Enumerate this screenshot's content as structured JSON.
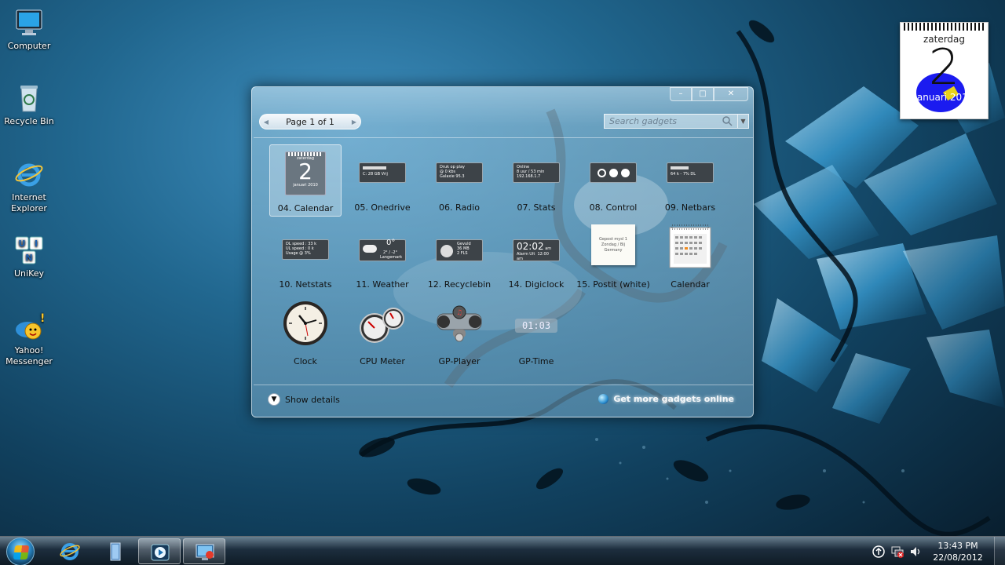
{
  "desktop": {
    "icons": [
      {
        "label": "Computer",
        "icon": "computer-icon"
      },
      {
        "label": "Recycle Bin",
        "icon": "recycle-bin-icon"
      },
      {
        "label": "Internet Explorer",
        "icon": "internet-explorer-icon"
      },
      {
        "label": "UniKey",
        "icon": "unikey-icon"
      },
      {
        "label": "Yahoo! Messenger",
        "icon": "yahoo-messenger-icon"
      }
    ]
  },
  "calendar_gadget": {
    "day_name": "zaterdag",
    "day_number": "2",
    "month_year": "januari 2010"
  },
  "gallery": {
    "page_label": "Page 1 of 1",
    "search_placeholder": "Search gadgets",
    "show_details": "Show details",
    "online_link": "Get more gadgets online",
    "gadgets": [
      {
        "name": "04. Calendar",
        "selected": true
      },
      {
        "name": "05. Onedrive"
      },
      {
        "name": "06. Radio"
      },
      {
        "name": "07. Stats"
      },
      {
        "name": "08. Control"
      },
      {
        "name": "09. Netbars"
      },
      {
        "name": "10. Netstats"
      },
      {
        "name": "11. Weather"
      },
      {
        "name": "12. Recyclebin"
      },
      {
        "name": "14. Digiclock"
      },
      {
        "name": "15. Postit (white)"
      },
      {
        "name": "Calendar"
      },
      {
        "name": "Clock"
      },
      {
        "name": "CPU Meter"
      },
      {
        "name": "GP-Player"
      },
      {
        "name": "GP-Time"
      }
    ],
    "thumbs": {
      "calendar_day": "zaterdag",
      "calendar_num": "2",
      "calendar_month": "januari 2010",
      "onedrive": "C: 28 GB Vrij",
      "radio_line1": "Druk op play",
      "radio_line2": "@ 0 kbs",
      "radio_line3": "Galaxie 95.3",
      "stats_line1": "Online",
      "stats_line2": "8 uur / 53 min",
      "stats_line3": "192.168.1.7",
      "netbars": "64 k - 7% DL",
      "netstats_line1": "DL speed : 33 k",
      "netstats_line2": "UL speed : 0 k",
      "netstats_line3": "Usage @ 3%",
      "weather_temp": "0°",
      "weather_range": "2° / -2°",
      "weather_place": "Langemark",
      "recycle_line1": "Gevuld",
      "recycle_line2": "36 MB",
      "recycle_line3": "2 FLS",
      "digiclock_time": "02:02",
      "digiclock_suffix": "am",
      "digiclock_sub": "Alarm Uit",
      "digiclock_date": "12:00 am",
      "postit_text": "Gepost mysl 1 Zondag / Bij Germany",
      "gptime": "01:03"
    }
  },
  "taskbar": {
    "clock_time": "13:43 PM",
    "clock_date": "22/08/2012"
  }
}
